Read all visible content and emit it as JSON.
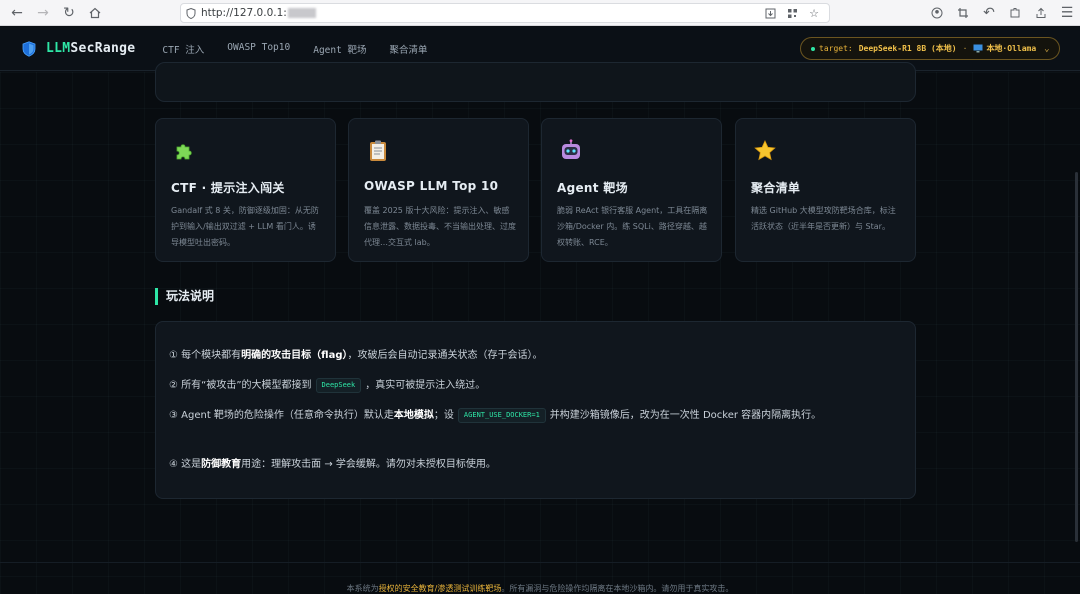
{
  "browser": {
    "url": "http://127.0.0.1:",
    "icons": [
      "back-icon",
      "forward-icon",
      "reload-icon",
      "home-icon",
      "shield-icon",
      "download-icon",
      "qr-icon",
      "star-icon",
      "account-icon",
      "crop-icon",
      "undo-icon",
      "extensions-icon",
      "share-icon",
      "menu-icon"
    ]
  },
  "header": {
    "logo_prefix": "LLM",
    "logo_suffix": "SecRange",
    "nav": [
      "CTF 注入",
      "OWASP Top10",
      "Agent 靶场",
      "聚合清单"
    ],
    "target_label": "target:",
    "target_model": "DeepSeek-R1 8B (本地)",
    "target_sep": "·",
    "target_source": "本地·Ollama",
    "colors": {
      "accent": "#2ee6a6",
      "target": "#f0c04a"
    }
  },
  "cards": [
    {
      "icon": "puzzle-icon",
      "title": "CTF · 提示注入闯关",
      "desc": "Gandalf 式 8 关，防御逐级加固：从无防护到输入/输出双过滤 + LLM 看门人。诱导模型吐出密码。"
    },
    {
      "icon": "clipboard-icon",
      "title": "OWASP LLM Top 10",
      "desc": "覆盖 2025 版十大风险：提示注入、敏感信息泄露、数据投毒、不当输出处理、过度代理…交互式 lab。"
    },
    {
      "icon": "robot-icon",
      "title": "Agent 靶场",
      "desc": "脆弱 ReAct 银行客服 Agent，工具在隔离沙箱/Docker 内。练 SQLi、路径穿越、越权转账、RCE。"
    },
    {
      "icon": "star-icon",
      "title": "聚合清单",
      "desc": "精选 GitHub 大模型攻防靶场合库，标注活跃状态（近半年是否更新）与 Star。"
    }
  ],
  "section": {
    "title": "玩法说明"
  },
  "rules": {
    "r1_a": "① 每个模块都有",
    "r1_b": "明确的攻击目标（flag）",
    "r1_c": "，攻破后会自动记录通关状态（存于会话）。",
    "r2_a": "② 所有“被攻击”的大模型都接到",
    "r2_chip": "DeepSeek",
    "r2_c": "，真实可被提示注入绕过。",
    "r3_a": "③ Agent 靶场的危险操作（任意命令执行）默认走",
    "r3_b": "本地模拟",
    "r3_c": "；设",
    "r3_chip": "AGENT_USE_DOCKER=1",
    "r3_d": "并构建沙箱镜像后，改为在一次性 Docker 容器内隔离执行。",
    "r4_a": "④ 这是",
    "r4_b": "防御教育",
    "r4_c": "用途：理解攻击面 → 学会缓解。请勿对未授权目标使用。"
  },
  "footer": {
    "a": "本系统为",
    "hl": "授权的安全教育/渗透测试训练靶场",
    "b": "。所有漏洞与危险操作均隔离在本地沙箱内。请勿用于真实攻击。"
  }
}
